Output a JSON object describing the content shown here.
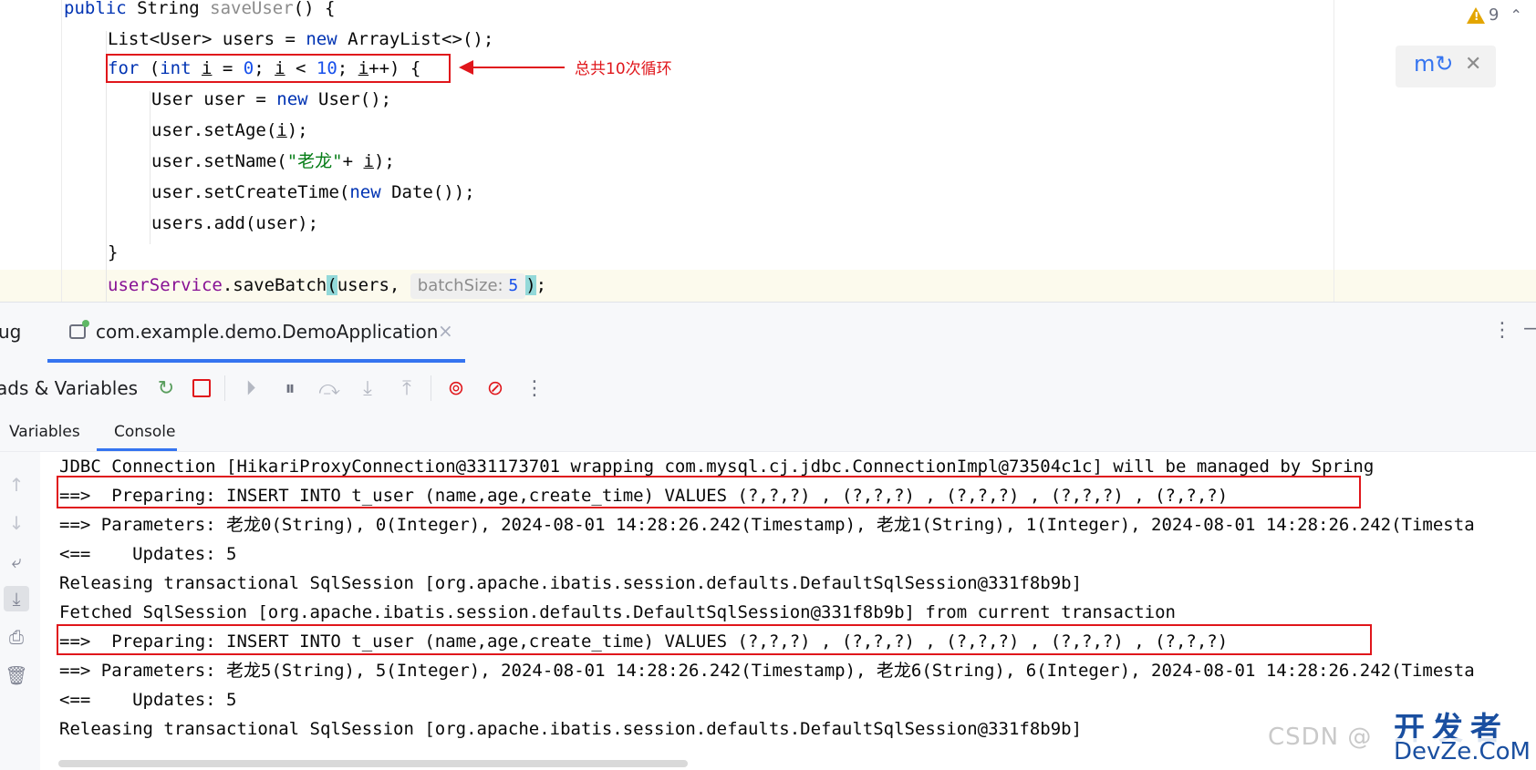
{
  "editor": {
    "lines": [
      {
        "tokens": [
          [
            "kw",
            "public"
          ],
          [
            "p",
            " String "
          ],
          [
            "dim",
            "saveUser"
          ],
          [
            "p",
            "() {"
          ]
        ]
      },
      {
        "tokens": [
          [
            "p",
            "List<User> users = "
          ],
          [
            "kw",
            "new"
          ],
          [
            "p",
            " ArrayList<>();"
          ]
        ]
      },
      {
        "tokens": [
          [
            "kw",
            "for"
          ],
          [
            "p",
            " ("
          ],
          [
            "kw",
            "int"
          ],
          [
            "p",
            " "
          ],
          [
            "u",
            "i"
          ],
          [
            "p",
            " = "
          ],
          [
            "num",
            "0"
          ],
          [
            "p",
            "; "
          ],
          [
            "u",
            "i"
          ],
          [
            "p",
            " < "
          ],
          [
            "num",
            "10"
          ],
          [
            "p",
            "; "
          ],
          [
            "u",
            "i"
          ],
          [
            "p",
            "++) {"
          ]
        ]
      },
      {
        "tokens": [
          [
            "p",
            "User user = "
          ],
          [
            "kw",
            "new"
          ],
          [
            "p",
            " User();"
          ]
        ]
      },
      {
        "tokens": [
          [
            "p",
            "user.setAge("
          ],
          [
            "u",
            "i"
          ],
          [
            "p",
            ");"
          ]
        ]
      },
      {
        "tokens": [
          [
            "p",
            "user.setName("
          ],
          [
            "str",
            "\"老龙\""
          ],
          [
            "p",
            "+ "
          ],
          [
            "u",
            "i"
          ],
          [
            "p",
            ");"
          ]
        ]
      },
      {
        "tokens": [
          [
            "p",
            "user.setCreateTime("
          ],
          [
            "kw",
            "new"
          ],
          [
            "p",
            " Date());"
          ]
        ]
      },
      {
        "tokens": [
          [
            "p",
            "users.add(user);"
          ]
        ]
      },
      {
        "tokens": [
          [
            "p",
            "}"
          ]
        ]
      },
      {
        "tokens": [
          [
            "fld",
            "userService"
          ],
          [
            "p",
            ".saveBatch"
          ],
          [
            "hl",
            "("
          ],
          [
            "p",
            "users, "
          ]
        ]
      }
    ],
    "inlay_hint_name": "batchSize:",
    "inlay_hint_value": "5",
    "last_line_tail": ");",
    "annotation": "总共10次循环",
    "warnings_count": "9",
    "icons": {
      "warning": "warning-triangle-icon",
      "collapse": "chevron-up-icon",
      "reload_changes": "maven-reload-icon",
      "close": "close-icon"
    }
  },
  "debug": {
    "title": "ug",
    "run_tab_label": "com.example.demo.DemoApplication",
    "toolbar_label": "ads & Variables",
    "subtabs": [
      "Variables",
      "Console"
    ],
    "active_subtab": "Console"
  },
  "console": {
    "lines": [
      "JDBC Connection [HikariProxyConnection@331173701 wrapping com.mysql.cj.jdbc.ConnectionImpl@73504c1c] will be managed by Spring",
      "==>  Preparing: INSERT INTO t_user (name,age,create_time) VALUES (?,?,?) , (?,?,?) , (?,?,?) , (?,?,?) , (?,?,?)",
      "==> Parameters: 老龙0(String), 0(Integer), 2024-08-01 14:28:26.242(Timestamp), 老龙1(String), 1(Integer), 2024-08-01 14:28:26.242(Timesta",
      "<==    Updates: 5",
      "Releasing transactional SqlSession [org.apache.ibatis.session.defaults.DefaultSqlSession@331f8b9b]",
      "Fetched SqlSession [org.apache.ibatis.session.defaults.DefaultSqlSession@331f8b9b] from current transaction",
      "==>  Preparing: INSERT INTO t_user (name,age,create_time) VALUES (?,?,?) , (?,?,?) , (?,?,?) , (?,?,?) , (?,?,?)",
      "==> Parameters: 老龙5(String), 5(Integer), 2024-08-01 14:28:26.242(Timestamp), 老龙6(String), 6(Integer), 2024-08-01 14:28:26.242(Timesta",
      "<==    Updates: 5",
      "Releasing transactional SqlSession [org.apache.ibatis.session.defaults.DefaultSqlSession@331f8b9b]"
    ]
  },
  "watermark": {
    "csdn": "CSDN @",
    "brand_top": "开发者",
    "brand_bottom": "DevZe.CoM"
  },
  "colors": {
    "annotation_red": "#e0161b",
    "keyword": "#0033b3",
    "number": "#1750eb",
    "string": "#067d17",
    "accent": "#3574f0"
  }
}
